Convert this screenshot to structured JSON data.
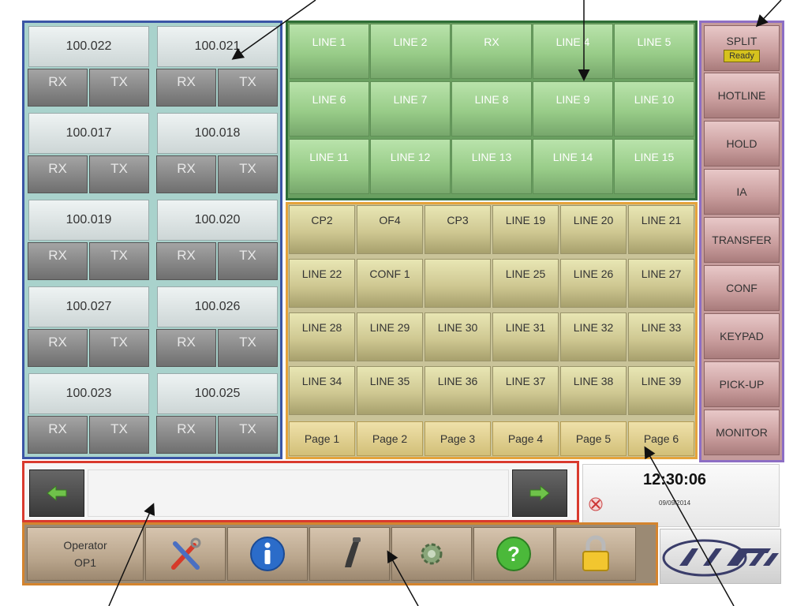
{
  "radio": {
    "cells": [
      {
        "freq": "100.022",
        "rx": "RX",
        "tx": "TX"
      },
      {
        "freq": "100.021",
        "rx": "RX",
        "tx": "TX"
      },
      {
        "freq": "100.017",
        "rx": "RX",
        "tx": "TX"
      },
      {
        "freq": "100.018",
        "rx": "RX",
        "tx": "TX"
      },
      {
        "freq": "100.019",
        "rx": "RX",
        "tx": "TX"
      },
      {
        "freq": "100.020",
        "rx": "RX",
        "tx": "TX"
      },
      {
        "freq": "100.027",
        "rx": "RX",
        "tx": "TX"
      },
      {
        "freq": "100.026",
        "rx": "RX",
        "tx": "TX"
      },
      {
        "freq": "100.023",
        "rx": "RX",
        "tx": "TX"
      },
      {
        "freq": "100.025",
        "rx": "RX",
        "tx": "TX"
      }
    ]
  },
  "green_lines": [
    "LINE 1",
    "LINE 2",
    "RX",
    "LINE 4",
    "LINE 5",
    "LINE 6",
    "LINE 7",
    "LINE 8",
    "LINE 9",
    "LINE 10",
    "LINE 11",
    "LINE 12",
    "LINE 13",
    "LINE 14",
    "LINE 15"
  ],
  "yellow_lines": [
    "CP2",
    "OF4",
    "CP3",
    "LINE 19",
    "LINE 20",
    "LINE 21",
    "LINE 22",
    "CONF 1",
    "",
    "LINE 25",
    "LINE 26",
    "LINE 27",
    "LINE 28",
    "LINE 29",
    "LINE 30",
    "LINE 31",
    "LINE 32",
    "LINE 33",
    "LINE 34",
    "LINE 35",
    "LINE 36",
    "LINE 37",
    "LINE 38",
    "LINE 39"
  ],
  "pages": [
    "Page 1",
    "Page 2",
    "Page 3",
    "Page 4",
    "Page 5",
    "Page 6"
  ],
  "functions": {
    "split": {
      "label": "SPLIT",
      "status": "Ready"
    },
    "buttons": [
      "HOTLINE",
      "HOLD",
      "IA",
      "TRANSFER",
      "CONF",
      "KEYPAD",
      "PICK-UP",
      "MONITOR"
    ]
  },
  "clock": {
    "time": "12:30:06",
    "date": "09/09/2014"
  },
  "operator": {
    "title": "Operator",
    "id": "OP1"
  },
  "toolbar_icons": [
    "tools-icon",
    "info-icon",
    "handset-icon",
    "settings-icon",
    "help-icon",
    "lock-icon"
  ],
  "colors": {
    "radio_border": "#3a55a6",
    "green_border": "#2f6e36",
    "yellow_border": "#e5a33b",
    "function_border": "#8d6ec4",
    "message_border": "#d93a2e",
    "toolbar_border": "#d4842e",
    "ready_badge": "#d6c21d"
  }
}
